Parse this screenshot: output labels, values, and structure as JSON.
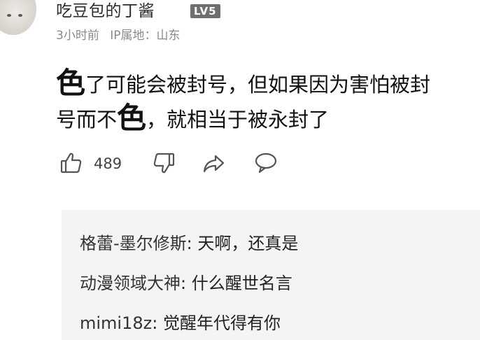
{
  "comment": {
    "username": "吃豆包的丁酱",
    "badge": "LV5",
    "time": "3小时前",
    "ip_location": "IP属地：山东",
    "text": {
      "line1_first": "色",
      "line1_rest": "了可能会被封号，但如果因为害怕被封",
      "line2_start": "号而不",
      "line2_big": "色",
      "line2_rest": "，就相当于被永封了"
    },
    "like_count": "489"
  },
  "icons": {
    "like": "thumbs-up-icon",
    "dislike": "thumbs-down-icon",
    "share": "share-icon",
    "reply": "comment-bubble-icon"
  },
  "replies": [
    {
      "author": "格蕾-墨尔修斯",
      "separator": ": ",
      "text": "天啊，还真是"
    },
    {
      "author": "动漫领域大神",
      "separator": ": ",
      "text": "什么醒世名言"
    },
    {
      "author": "mimi18z",
      "separator": ": ",
      "text": "觉醒年代得有你"
    }
  ],
  "colors": {
    "text": "#111111",
    "meta": "#8a8a8a",
    "badge_bg": "#6f6f6f",
    "replies_bg": "#f4f4f4"
  }
}
